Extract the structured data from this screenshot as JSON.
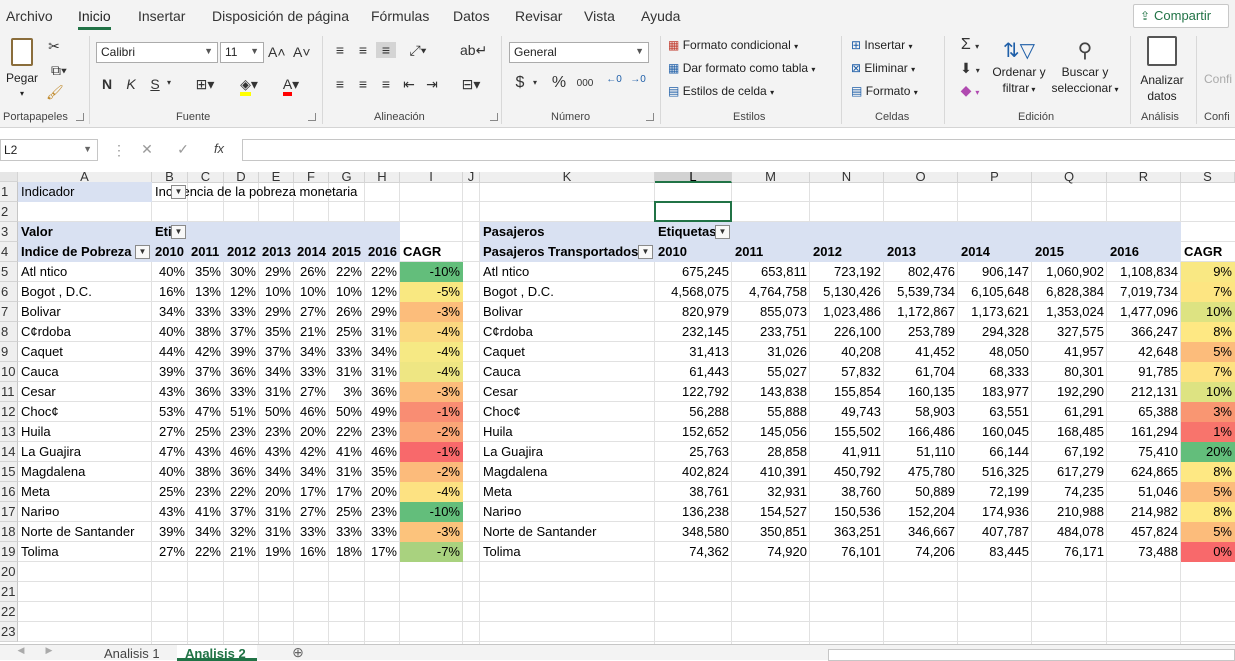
{
  "ribbon_tabs": [
    "Archivo",
    "Inicio",
    "Insertar",
    "Disposición de página",
    "Fórmulas",
    "Datos",
    "Revisar",
    "Vista",
    "Ayuda"
  ],
  "share_label": "Compartir",
  "clipboard": {
    "paste": "Pegar",
    "group": "Portapapeles"
  },
  "font": {
    "name": "Calibri",
    "size": "11",
    "bold": "N",
    "italic": "K",
    "underline": "S",
    "group": "Fuente"
  },
  "alignment": {
    "group": "Alineación"
  },
  "number": {
    "format": "General",
    "currency": "$",
    "percent": "%",
    "thousands": "000",
    "group": "Número"
  },
  "styles": {
    "conditional": "Formato condicional",
    "table": "Dar formato como tabla",
    "cell_styles": "Estilos de celda",
    "group": "Estilos"
  },
  "cells": {
    "insert": "Insertar",
    "delete": "Eliminar",
    "format": "Formato",
    "group": "Celdas"
  },
  "editing": {
    "sort_line1": "Ordenar y",
    "sort_line2": "filtrar",
    "find_line1": "Buscar y",
    "find_line2": "seleccionar",
    "group": "Edición"
  },
  "analysis": {
    "line1": "Analizar",
    "line2": "datos",
    "group": "Análisis",
    "confi": "Confi",
    "confi2": "Confi"
  },
  "name_box": "L2",
  "formula_symbols": {
    "cancel": "✕",
    "enter": "✓",
    "fx": "fx"
  },
  "columns": [
    "A",
    "B",
    "C",
    "D",
    "E",
    "F",
    "G",
    "H",
    "I",
    "J",
    "K",
    "L",
    "M",
    "N",
    "O",
    "P",
    "Q",
    "R",
    "S"
  ],
  "rows": [
    "1",
    "2",
    "3",
    "4",
    "5",
    "6",
    "7",
    "8",
    "9",
    "10",
    "11",
    "12",
    "13",
    "14",
    "15",
    "16",
    "17",
    "18",
    "19",
    "20",
    "21",
    "22",
    "23"
  ],
  "pivot1": {
    "indicator_label": "Indicador",
    "indicator_value": "Incidencia de la pobreza monetaria",
    "value_label": "Valor",
    "col_label": "Eti",
    "row_label": "Indice de Pobreza",
    "years": [
      "2010",
      "2011",
      "2012",
      "2013",
      "2014",
      "2015",
      "2016"
    ],
    "cagr_label": "CAGR",
    "rows": [
      {
        "name": "Atl ntico",
        "v": [
          "40%",
          "35%",
          "30%",
          "29%",
          "26%",
          "22%",
          "22%"
        ],
        "cagr": "-10%",
        "color": "#63be7b"
      },
      {
        "name": "Bogot , D.C.",
        "v": [
          "16%",
          "13%",
          "12%",
          "10%",
          "10%",
          "10%",
          "12%"
        ],
        "cagr": "-5%",
        "color": "#f9e881"
      },
      {
        "name": "Bolivar",
        "v": [
          "34%",
          "33%",
          "33%",
          "29%",
          "27%",
          "26%",
          "29%"
        ],
        "cagr": "-3%",
        "color": "#fcbd7b"
      },
      {
        "name": "C¢rdoba",
        "v": [
          "40%",
          "38%",
          "37%",
          "35%",
          "21%",
          "25%",
          "31%"
        ],
        "cagr": "-4%",
        "color": "#fbd880"
      },
      {
        "name": "Caquet",
        "v": [
          "44%",
          "42%",
          "39%",
          "37%",
          "34%",
          "33%",
          "34%"
        ],
        "cagr": "-4%",
        "color": "#f6e984"
      },
      {
        "name": "Cauca",
        "v": [
          "39%",
          "37%",
          "36%",
          "34%",
          "33%",
          "31%",
          "31%"
        ],
        "cagr": "-4%",
        "color": "#eee683"
      },
      {
        "name": "Cesar",
        "v": [
          "43%",
          "36%",
          "33%",
          "31%",
          "27%",
          "3%",
          "36%"
        ],
        "cagr": "-3%",
        "color": "#fcbc7b"
      },
      {
        "name": "Choc¢",
        "v": [
          "53%",
          "47%",
          "51%",
          "50%",
          "46%",
          "50%",
          "49%"
        ],
        "cagr": "-1%",
        "color": "#f98d73"
      },
      {
        "name": "Huila",
        "v": [
          "27%",
          "25%",
          "23%",
          "23%",
          "20%",
          "22%",
          "23%"
        ],
        "cagr": "-2%",
        "color": "#fba777"
      },
      {
        "name": "La Guajira",
        "v": [
          "47%",
          "43%",
          "46%",
          "43%",
          "42%",
          "41%",
          "46%"
        ],
        "cagr": "-1%",
        "color": "#f8696b"
      },
      {
        "name": "Magdalena",
        "v": [
          "40%",
          "38%",
          "36%",
          "34%",
          "34%",
          "31%",
          "35%"
        ],
        "cagr": "-2%",
        "color": "#fcbb7b"
      },
      {
        "name": "Meta",
        "v": [
          "25%",
          "23%",
          "22%",
          "20%",
          "17%",
          "17%",
          "20%"
        ],
        "cagr": "-4%",
        "color": "#fde282"
      },
      {
        "name": "Nari¤o",
        "v": [
          "43%",
          "41%",
          "37%",
          "31%",
          "27%",
          "25%",
          "23%"
        ],
        "cagr": "-10%",
        "color": "#63be7b"
      },
      {
        "name": "Norte de Santander",
        "v": [
          "39%",
          "34%",
          "32%",
          "31%",
          "33%",
          "33%",
          "33%"
        ],
        "cagr": "-3%",
        "color": "#fcc37c"
      },
      {
        "name": "Tolima",
        "v": [
          "27%",
          "22%",
          "21%",
          "19%",
          "16%",
          "18%",
          "17%"
        ],
        "cagr": "-7%",
        "color": "#a9d27f"
      }
    ]
  },
  "pivot2": {
    "value_label": "Pasajeros",
    "col_label": "Etiquetas",
    "row_label": "Pasajeros Transportados",
    "years": [
      "2010",
      "2011",
      "2012",
      "2013",
      "2014",
      "2015",
      "2016"
    ],
    "cagr_label": "CAGR",
    "rows": [
      {
        "name": "Atl ntico",
        "v": [
          "675,245",
          "653,811",
          "723,192",
          "802,476",
          "906,147",
          "1,060,902",
          "1,108,834"
        ],
        "cagr": "9%",
        "color": "#f9e883"
      },
      {
        "name": "Bogot , D.C.",
        "v": [
          "4,568,075",
          "4,764,758",
          "5,130,426",
          "5,539,734",
          "6,105,648",
          "6,828,384",
          "7,019,734"
        ],
        "cagr": "7%",
        "color": "#fde582"
      },
      {
        "name": "Bolivar",
        "v": [
          "820,979",
          "855,073",
          "1,023,486",
          "1,172,867",
          "1,173,621",
          "1,353,024",
          "1,477,096"
        ],
        "cagr": "10%",
        "color": "#dde382"
      },
      {
        "name": "C¢rdoba",
        "v": [
          "232,145",
          "233,751",
          "226,100",
          "253,789",
          "294,328",
          "327,575",
          "366,247"
        ],
        "cagr": "8%",
        "color": "#fee883"
      },
      {
        "name": "Caquet",
        "v": [
          "31,413",
          "31,026",
          "40,208",
          "41,452",
          "48,050",
          "41,957",
          "42,648"
        ],
        "cagr": "5%",
        "color": "#fcbc7b"
      },
      {
        "name": "Cauca",
        "v": [
          "61,443",
          "55,027",
          "57,832",
          "61,704",
          "68,333",
          "80,301",
          "91,785"
        ],
        "cagr": "7%",
        "color": "#fee282"
      },
      {
        "name": "Cesar",
        "v": [
          "122,792",
          "143,838",
          "155,854",
          "160,135",
          "183,977",
          "192,290",
          "212,131"
        ],
        "cagr": "10%",
        "color": "#dde382"
      },
      {
        "name": "Choc¢",
        "v": [
          "56,288",
          "55,888",
          "49,743",
          "58,903",
          "63,551",
          "61,291",
          "65,388"
        ],
        "cagr": "3%",
        "color": "#f99672"
      },
      {
        "name": "Huila",
        "v": [
          "152,652",
          "145,056",
          "155,502",
          "166,486",
          "160,045",
          "168,485",
          "161,294"
        ],
        "cagr": "1%",
        "color": "#f8746c"
      },
      {
        "name": "La Guajira",
        "v": [
          "25,763",
          "28,858",
          "41,911",
          "51,110",
          "66,144",
          "67,192",
          "75,410"
        ],
        "cagr": "20%",
        "color": "#63be7b"
      },
      {
        "name": "Magdalena",
        "v": [
          "402,824",
          "410,391",
          "450,792",
          "475,780",
          "516,325",
          "617,279",
          "624,865"
        ],
        "cagr": "8%",
        "color": "#fee883"
      },
      {
        "name": "Meta",
        "v": [
          "38,761",
          "32,931",
          "38,760",
          "50,889",
          "72,199",
          "74,235",
          "51,046"
        ],
        "cagr": "5%",
        "color": "#fcbc7b"
      },
      {
        "name": "Nari¤o",
        "v": [
          "136,238",
          "154,527",
          "150,536",
          "152,204",
          "174,936",
          "210,988",
          "214,982"
        ],
        "cagr": "8%",
        "color": "#fee883"
      },
      {
        "name": "Norte de Santander",
        "v": [
          "348,580",
          "350,851",
          "363,251",
          "346,667",
          "407,787",
          "484,078",
          "457,824"
        ],
        "cagr": "5%",
        "color": "#fcbc7b"
      },
      {
        "name": "Tolima",
        "v": [
          "74,362",
          "74,920",
          "76,101",
          "74,206",
          "83,445",
          "76,171",
          "73,488"
        ],
        "cagr": "0%",
        "color": "#f8696b"
      }
    ]
  },
  "sheet_tabs": [
    "Analisis 1",
    "Analisis 2"
  ],
  "add_sheet": "⊕"
}
